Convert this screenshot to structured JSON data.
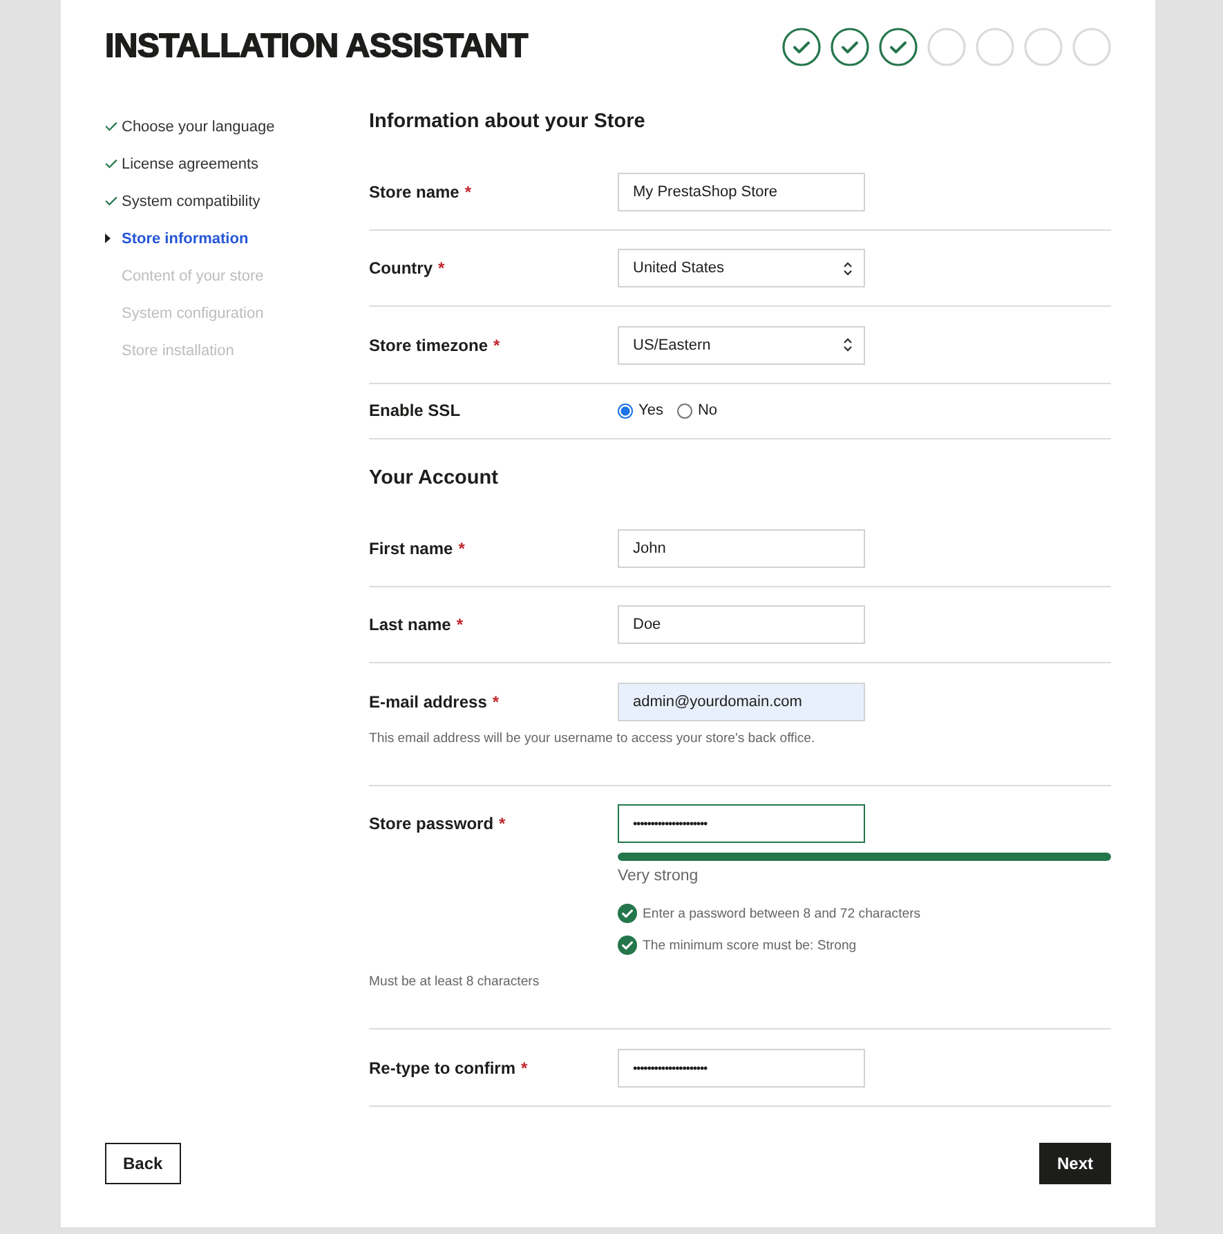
{
  "header": {
    "title": "INSTALLATION ASSISTANT",
    "progress": [
      {
        "done": true
      },
      {
        "done": true
      },
      {
        "done": true
      },
      {
        "done": false
      },
      {
        "done": false
      },
      {
        "done": false
      },
      {
        "done": false
      }
    ]
  },
  "sidebar": {
    "steps": [
      {
        "label": "Choose your language",
        "done": true,
        "selected": false
      },
      {
        "label": "License agreements",
        "done": true,
        "selected": false
      },
      {
        "label": "System compatibility",
        "done": true,
        "selected": false
      },
      {
        "label": "Store information",
        "done": false,
        "selected": true
      },
      {
        "label": "Content of your store",
        "done": false,
        "selected": false
      },
      {
        "label": "System configuration",
        "done": false,
        "selected": false
      },
      {
        "label": "Store installation",
        "done": false,
        "selected": false
      }
    ]
  },
  "store_section": {
    "title": "Information about your Store",
    "fields": [
      {
        "kind": "text",
        "label": "Store name",
        "required_mark": "*",
        "value": "My PrestaShop Store"
      },
      {
        "kind": "select",
        "label": "Country",
        "required_mark": "*",
        "value": "United States"
      },
      {
        "kind": "select",
        "label": "Store timezone",
        "required_mark": "*",
        "value": "US/Eastern"
      },
      {
        "kind": "radio",
        "label": "Enable SSL",
        "options": [
          {
            "label": "Yes",
            "selected": true
          },
          {
            "label": "No",
            "selected": false
          }
        ]
      }
    ]
  },
  "account_section": {
    "title": "Your Account",
    "fields": [
      {
        "kind": "text",
        "label": "First name",
        "required_mark": "*",
        "value": "John"
      },
      {
        "kind": "text",
        "label": "Last name",
        "required_mark": "*",
        "value": "Doe"
      },
      {
        "kind": "text",
        "label": "E-mail address",
        "required_mark": "*",
        "value": "admin@yourdomain.com",
        "autofilled": true,
        "help": "This email address will be your username to access your store's back office."
      },
      {
        "kind": "password",
        "label": "Store password",
        "required_mark": "*",
        "value": "•••••••••••••••••••••",
        "valid": true,
        "strength": {
          "level": 1,
          "label": "Very strong"
        },
        "rules": [
          {
            "text": "Enter a password between 8 and 72 characters",
            "met": true
          },
          {
            "text": "The minimum score must be: Strong",
            "met": true
          }
        ],
        "help": "Must be at least 8 characters"
      },
      {
        "kind": "password",
        "label": "Re-type to confirm",
        "required_mark": "*",
        "value": "•••••••••••••••••••••",
        "valid": false
      }
    ]
  },
  "buttons": [
    {
      "kind": "secondary",
      "label": "Back"
    },
    {
      "kind": "primary",
      "label": "Next"
    }
  ]
}
